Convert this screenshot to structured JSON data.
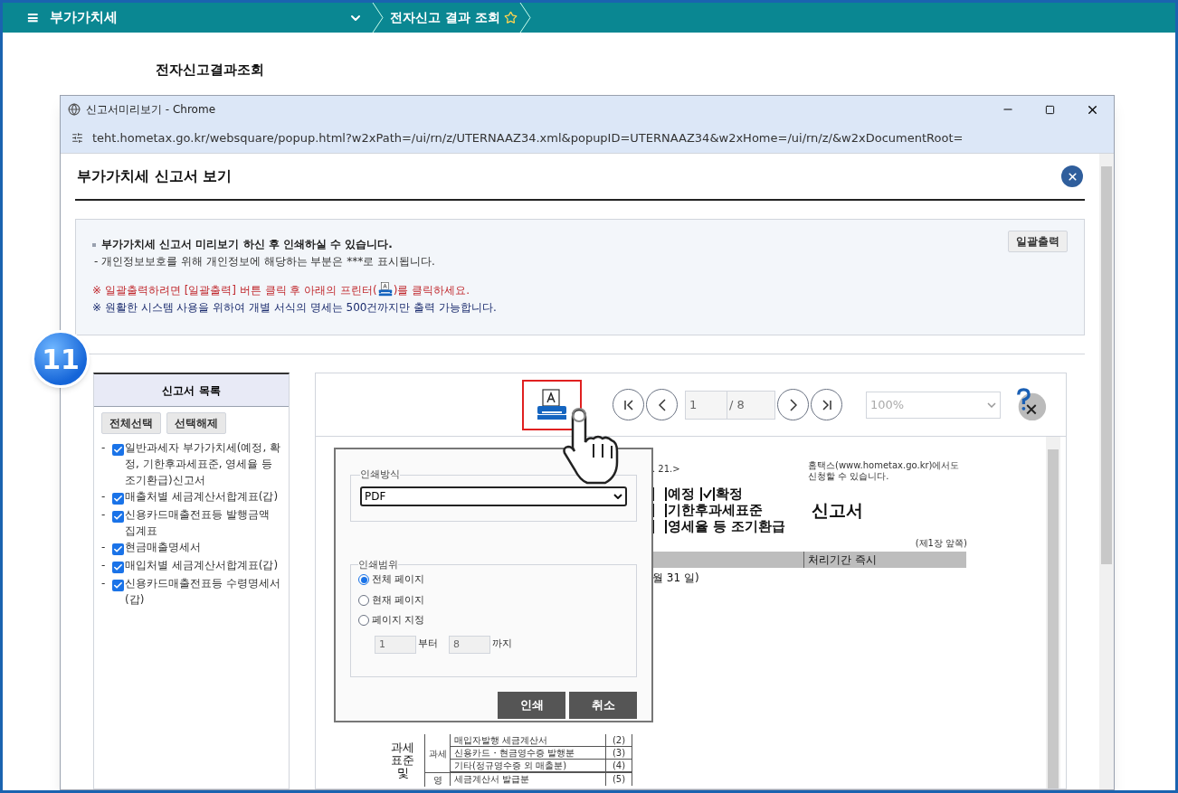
{
  "top_nav": {
    "menu_icon": "≡",
    "section": "부가가치세",
    "page": "전자신고 결과 조회",
    "favorite": false
  },
  "page_title": "전자신고결과조회",
  "popup": {
    "title": "신고서미리보기 - Chrome",
    "url": "teht.hometax.go.kr/websquare/popup.html?w2xPath=/ui/rn/z/UTERNAAZ34.xml&popupID=UTERNAAZ34&w2xHome=/ui/rn/z/&w2xDocumentRoot=",
    "heading": "부가가치세 신고서 보기"
  },
  "notice": {
    "lines": [
      {
        "kind": "bold",
        "text": "부가가치세 신고서 미리보기 하신 후 인쇄하실 수 있습니다."
      },
      {
        "kind": "plain",
        "text": "- 개인정보보호를 위해 개인정보에 해당하는 부분은   ***로 표시됩니다."
      },
      {
        "kind": "warning",
        "text": "※ 일괄출력하려면 [일괄출력] 버튼 클릭 후 아래의 프린터(",
        "text_after": ")를 클릭하세요."
      },
      {
        "kind": "info",
        "text": "※ 원활한 시스템 사용을 위하여 개별 서식의 명세는 500건까지만 출력 가능합니다."
      }
    ],
    "batch_button": "일괄출력"
  },
  "step_badge": "11",
  "form_list": {
    "title": "신고서 목록",
    "buttons": [
      "전체선택",
      "선택해제"
    ],
    "items": [
      {
        "bullet": "-",
        "label": "일반과세자 부가가치세(예정, 확정, 기한후과세표준, 영세율 등 조기환급)신고서",
        "checked": true
      },
      {
        "bullet": "-",
        "label": "매출처별 세금계산서합계표(갑)",
        "checked": true
      },
      {
        "bullet": "-",
        "label": "신용카드매출전표등 발행금액 집계표",
        "checked": true
      },
      {
        "bullet": "-",
        "label": "현금매출명세서",
        "checked": true
      },
      {
        "bullet": "-",
        "label": "매입처별 세금계산서합계표(갑)",
        "checked": true
      },
      {
        "bullet": "-",
        "label": "신용카드매출전표등 수령명세서(갑)",
        "checked": true
      }
    ]
  },
  "viewer": {
    "page": "1",
    "page_total": "/ 8",
    "zoom": "100%"
  },
  "print_dialog": {
    "method_legend": "인쇄방식",
    "method": "PDF",
    "range_legend": "인쇄범위",
    "options": [
      {
        "label": "전체 페이지",
        "selected": true
      },
      {
        "label": "현재 페이지",
        "selected": false
      },
      {
        "label": "페이지 지정",
        "selected": false
      }
    ],
    "from": "1",
    "from_suffix": "부터",
    "to": "8",
    "to_suffix": "까지",
    "print_button": "인쇄",
    "cancel_button": "취소"
  },
  "document": {
    "header_note": ". 21.>",
    "site_note": [
      "홈택스(www.hometax.go.kr)에서도",
      "신청할 수 있습니다."
    ],
    "types": [
      [
        {
          "label": "예정",
          "checked": false
        },
        {
          "label": "확정",
          "checked": true
        }
      ],
      [
        {
          "label": "기한후과세표준",
          "checked": false
        }
      ],
      [
        {
          "label": "영세율 등 조기환급",
          "checked": false
        }
      ]
    ],
    "title": "신고서",
    "page_note": "(제1장 앞쪽)",
    "processing": "처리기간 즉시",
    "period_end": "월   31 일)",
    "table": {
      "group": "과세 표준 및",
      "subgroup": "과세",
      "subgroup_2": "영",
      "rows": [
        {
          "label": "매입자발행 세금계산서",
          "no": "(2)"
        },
        {
          "label": "신용카드・현금영수증 발행분",
          "no": "(3)"
        },
        {
          "label": "기타(정규영수증 외 매출분)",
          "no": "(4)"
        },
        {
          "label": "세금계산서 발급분",
          "no": "(5)"
        }
      ]
    }
  }
}
